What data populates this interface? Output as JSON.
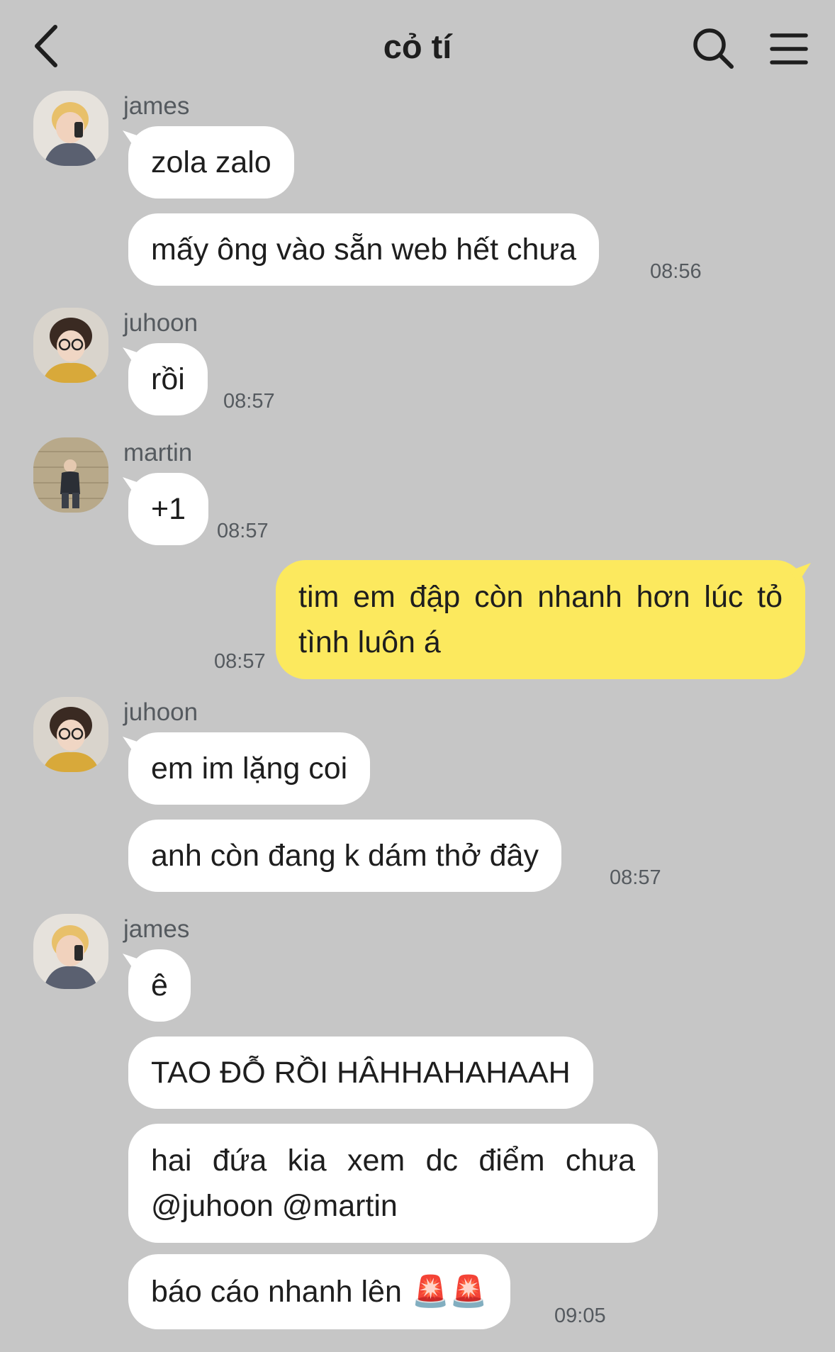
{
  "header": {
    "title": "cỏ tí",
    "back_icon": "chevron-left-icon",
    "search_icon": "search-icon",
    "menu_icon": "hamburger-menu-icon"
  },
  "messages": [
    {
      "sender": "james",
      "text": "zola zalo"
    },
    {
      "text": "mấy ông vào sẵn web hết chưa",
      "time": "08:56"
    },
    {
      "sender": "juhoon",
      "text": "rồi",
      "time": "08:57"
    },
    {
      "sender": "martin",
      "text": "+1",
      "time": "08:57"
    },
    {
      "text": "tim em đập còn nhanh hơn lúc tỏ tình luôn á",
      "time": "08:57",
      "mine": true
    },
    {
      "sender": "juhoon",
      "text": "em im lặng coi"
    },
    {
      "text": "anh còn đang k dám thở đây",
      "time": "08:57"
    },
    {
      "sender": "james",
      "text": "ê"
    },
    {
      "text": "TAO ĐỖ RỒI HÂHHAHAHAAH"
    },
    {
      "text": "hai đứa kia xem dc điểm chưa @juhoon @martin"
    },
    {
      "text": "báo cáo nhanh lên",
      "emoji": "🚨🚨",
      "time": "09:05"
    }
  ],
  "colors": {
    "background": "#c6c6c6",
    "incoming_bubble": "#ffffff",
    "outgoing_bubble": "#fce95e"
  }
}
